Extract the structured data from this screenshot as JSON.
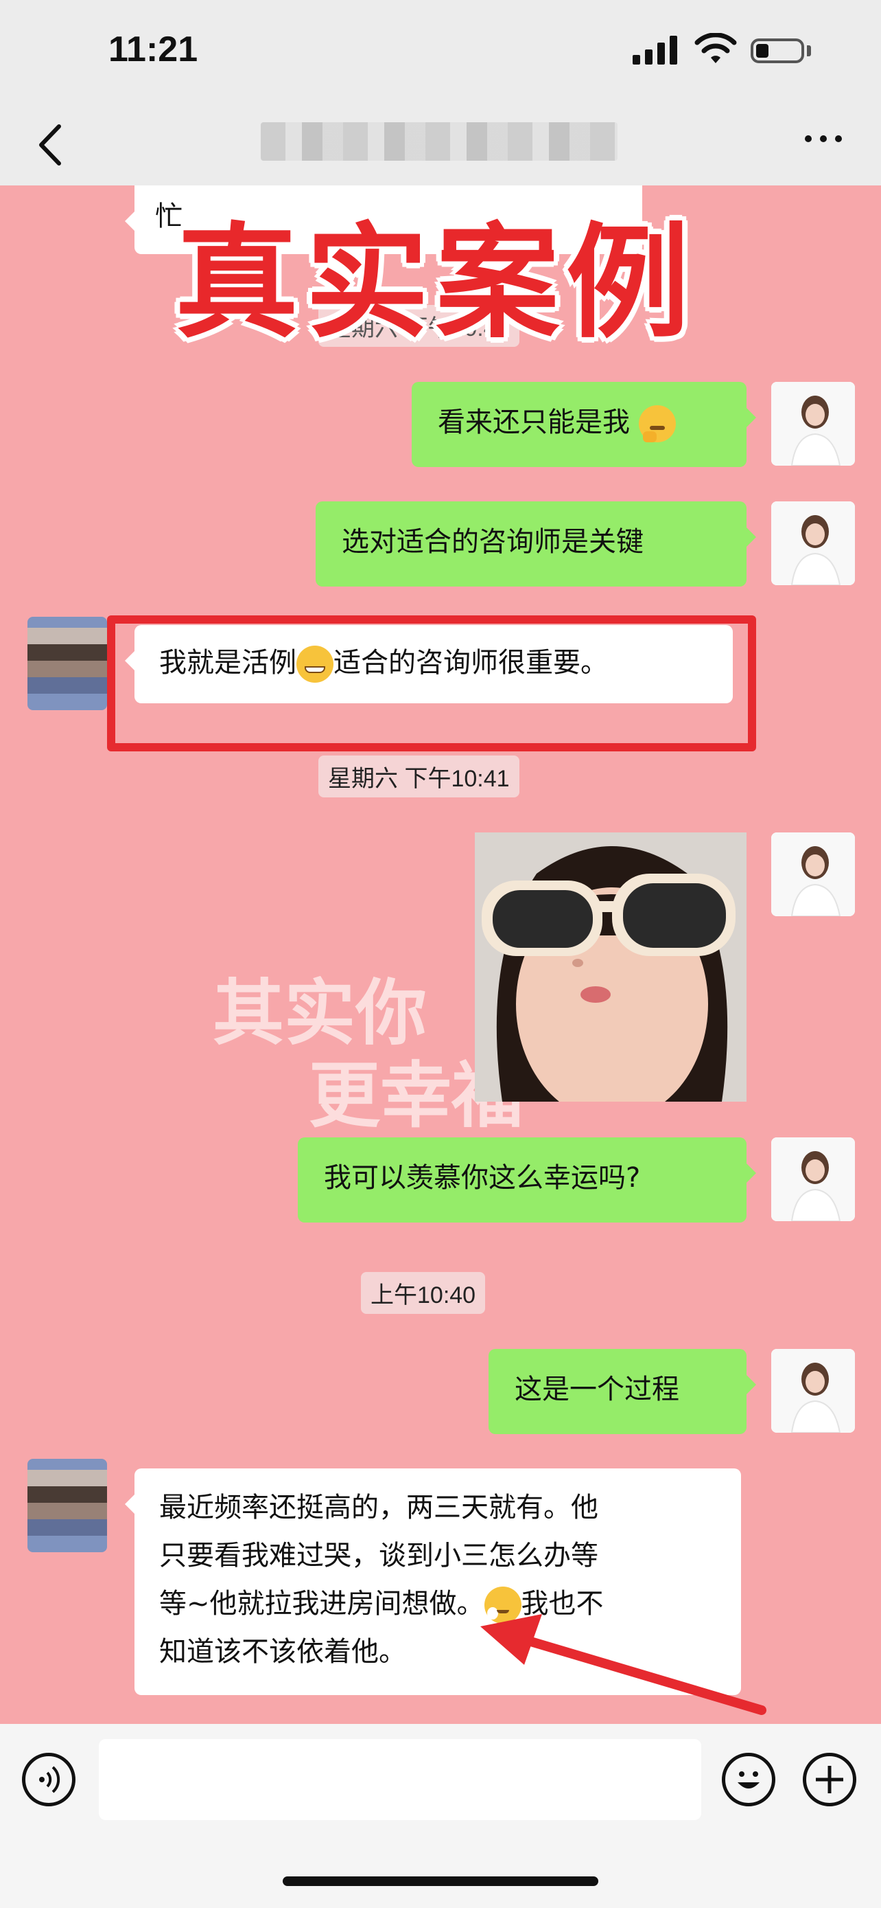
{
  "status_bar": {
    "time": "11:21"
  },
  "overlay": {
    "title": "真实案例",
    "watermark_line1": "其实你",
    "watermark_line2": "更幸福"
  },
  "messages": [
    {
      "side": "other",
      "text": "忙"
    },
    {
      "side": "timestamp",
      "text": "星期六 下午10:40"
    },
    {
      "side": "self",
      "text": "看来还只能是我"
    },
    {
      "side": "self",
      "text": "选对适合的咨询师是关键"
    },
    {
      "side": "other",
      "text_before": "我就是活例",
      "text_after": "适合的咨询师很重要。"
    },
    {
      "side": "timestamp",
      "text": "星期六 下午10:41"
    },
    {
      "side": "self",
      "type": "image"
    },
    {
      "side": "self",
      "text": "我可以羡慕你这么幸运吗?"
    },
    {
      "side": "timestamp",
      "text": "上午10:40"
    },
    {
      "side": "self",
      "text": "这是一个过程"
    },
    {
      "side": "other",
      "lines": [
        "最近频率还挺高的，两三天就有。他",
        "只要看我难过哭，谈到小三怎么办等",
        "等~他就拉我进房间想做。",
        "我也不",
        "知道该不该依着他。"
      ]
    }
  ],
  "icons": {
    "back": "chevron-left-icon",
    "more": "more-dots-icon",
    "voice": "voice-icon",
    "emoji": "emoji-icon",
    "plus": "plus-icon"
  },
  "colors": {
    "chat_bg": "#f7a7aa",
    "self_bubble": "#95ec69",
    "other_bubble": "#ffffff",
    "highlight": "#e62a2f"
  }
}
